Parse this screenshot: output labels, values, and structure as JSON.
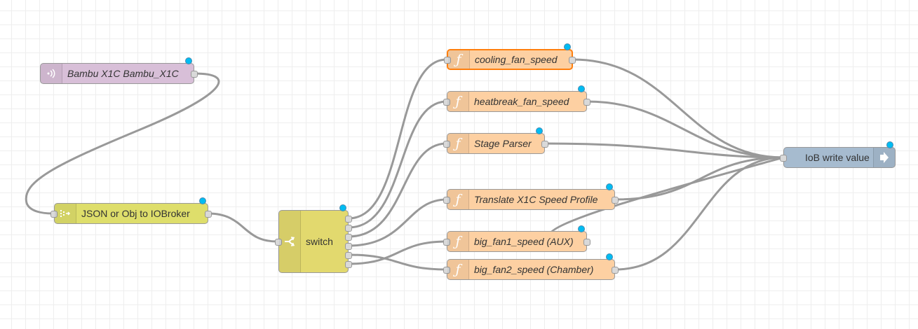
{
  "colors": {
    "function_node": "#fdd0a2",
    "mqtt_node": "#d8bfd8",
    "json_node": "#dede6b",
    "switch_node": "#e2d96e",
    "iob_node": "#a6bbcf",
    "wire": "#999999",
    "status_dot": "#00bcf2",
    "selected_border": "#ff7f0e"
  },
  "nodes": {
    "mqtt_in": {
      "label": "Bambu X1C Bambu_X1C",
      "icon": "mqtt-signal-icon"
    },
    "json": {
      "label": "JSON or Obj to IOBroker",
      "icon": "json-parser-icon"
    },
    "switch": {
      "label": "switch",
      "icon": "switch-branch-icon",
      "outputs": 6
    },
    "cooling_fan_speed": {
      "label": "cooling_fan_speed",
      "icon": "function-icon",
      "glyph": "ƒ"
    },
    "heatbreak_fan_speed": {
      "label": "heatbreak_fan_speed",
      "icon": "function-icon",
      "glyph": "ƒ"
    },
    "stage_parser": {
      "label": "Stage Parser",
      "icon": "function-icon",
      "glyph": "ƒ"
    },
    "translate_speed": {
      "label": "Translate X1C Speed Profile",
      "icon": "function-icon",
      "glyph": "ƒ"
    },
    "big_fan1": {
      "label": "big_fan1_speed (AUX)",
      "icon": "function-icon",
      "glyph": "ƒ"
    },
    "big_fan2": {
      "label": "big_fan2_speed (Chamber)",
      "icon": "function-icon",
      "glyph": "ƒ"
    },
    "iob_write": {
      "label": "IoB write value",
      "icon": "iob-output-icon"
    }
  }
}
